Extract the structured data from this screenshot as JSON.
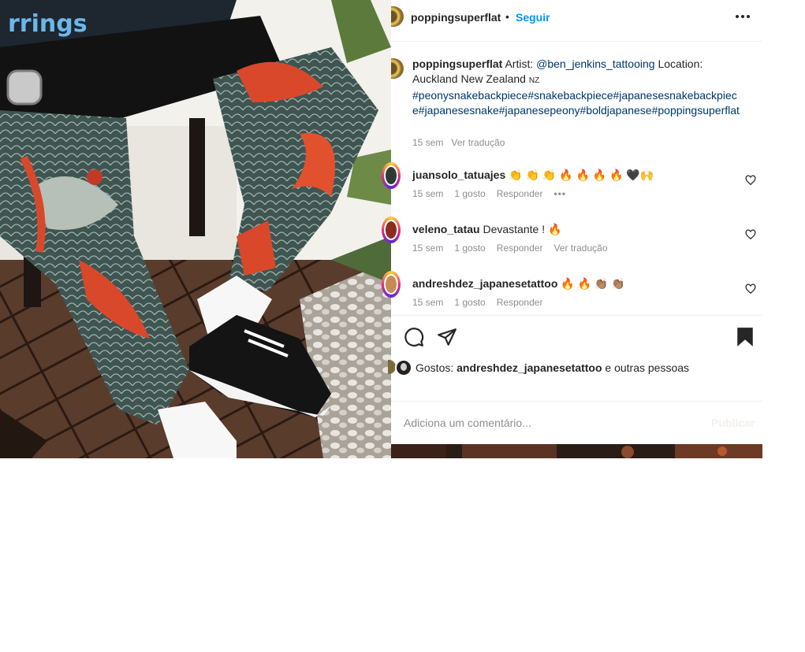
{
  "post": {
    "username": "poppingsuperflat",
    "separator": "•",
    "follow_label": "Seguir",
    "more_icon": "more-horizontal-icon"
  },
  "caption": {
    "username": "poppingsuperflat",
    "text_prefix": " Artist: ",
    "artist_tag": "@ben_jenkins_tattooing",
    "text_location": " Location: Auckland New Zealand",
    "flag": "NZ",
    "hashtags": "#peonysnakebackpiece#snakebackpiece#japanesesnakebackpiece#japanesesnake#japanesepeony#boldjapanese#poppingsuperflat",
    "time": "15 sem",
    "translate_label": "Ver tradução"
  },
  "comments": [
    {
      "username": "juansolo_tatuajes",
      "text": "👏 👏 👏 🔥 🔥 🔥 🔥 🖤🙌",
      "time": "15 sem",
      "likes": "1 gosto",
      "reply": "Responder",
      "extra": "•••"
    },
    {
      "username": "veleno_tatau",
      "text": "Devastante ! 🔥",
      "time": "15 sem",
      "likes": "1 gosto",
      "reply": "Responder",
      "extra": "Ver tradução"
    },
    {
      "username": "andreshdez_japanesetattoo",
      "text": "🔥 🔥 👏🏽 👏🏽",
      "time": "15 sem",
      "likes": "1 gosto",
      "reply": "Responder",
      "extra": ""
    }
  ],
  "actions": {
    "comment_icon": "comment-icon",
    "share_icon": "share-icon",
    "save_icon": "bookmark-icon"
  },
  "likes": {
    "prefix": "Gostos: ",
    "user": "andreshdez_japanesetattoo",
    "suffix": " e outras pessoas"
  },
  "add_comment": {
    "placeholder": "Adiciona um comentário...",
    "publish_label": "Publicar"
  },
  "colors": {
    "accent": "#0095f6",
    "link": "#00376b",
    "muted": "#8e8e8e",
    "text": "#262626"
  }
}
